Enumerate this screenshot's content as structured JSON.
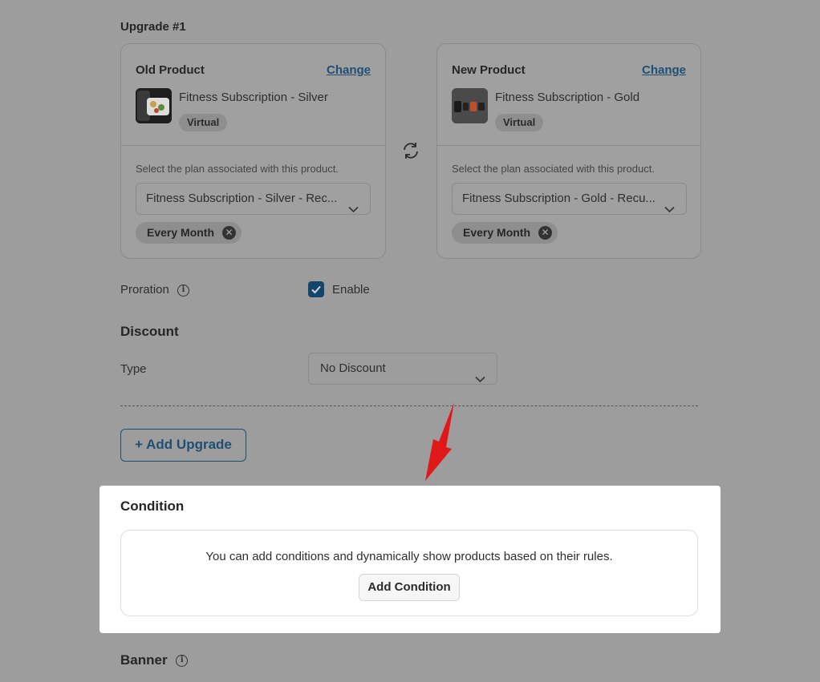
{
  "upgrade": {
    "heading": "Upgrade #1",
    "old_product": {
      "title": "Old Product",
      "change_label": "Change",
      "name": "Fitness Subscription - Silver",
      "badge": "Virtual",
      "plan_hint": "Select the plan associated with this product.",
      "plan_value": "Fitness Subscription - Silver - Rec...",
      "chip_label": "Every Month",
      "thumbnail_icon": "product-thumbnail"
    },
    "new_product": {
      "title": "New Product",
      "change_label": "Change",
      "name": "Fitness Subscription - Gold",
      "badge": "Virtual",
      "plan_hint": "Select the plan associated with this product.",
      "plan_value": "Fitness Subscription - Gold - Recu...",
      "chip_label": "Every Month",
      "thumbnail_icon": "product-thumbnail"
    },
    "swap_icon": "swap-icon"
  },
  "proration": {
    "label": "Proration",
    "checkbox_label": "Enable",
    "checked": true
  },
  "discount": {
    "heading": "Discount",
    "type_label": "Type",
    "type_value": "No Discount"
  },
  "add_upgrade_label": "+ Add Upgrade",
  "condition": {
    "heading": "Condition",
    "description": "You can add conditions and dynamically show products based on their rules.",
    "button_label": "Add Condition"
  },
  "banner": {
    "heading": "Banner"
  },
  "colors": {
    "overlay": "#9d9d9d",
    "accent": "#1f4f74",
    "arrow": "#e01818",
    "highlight_panel": "#ffffff"
  }
}
